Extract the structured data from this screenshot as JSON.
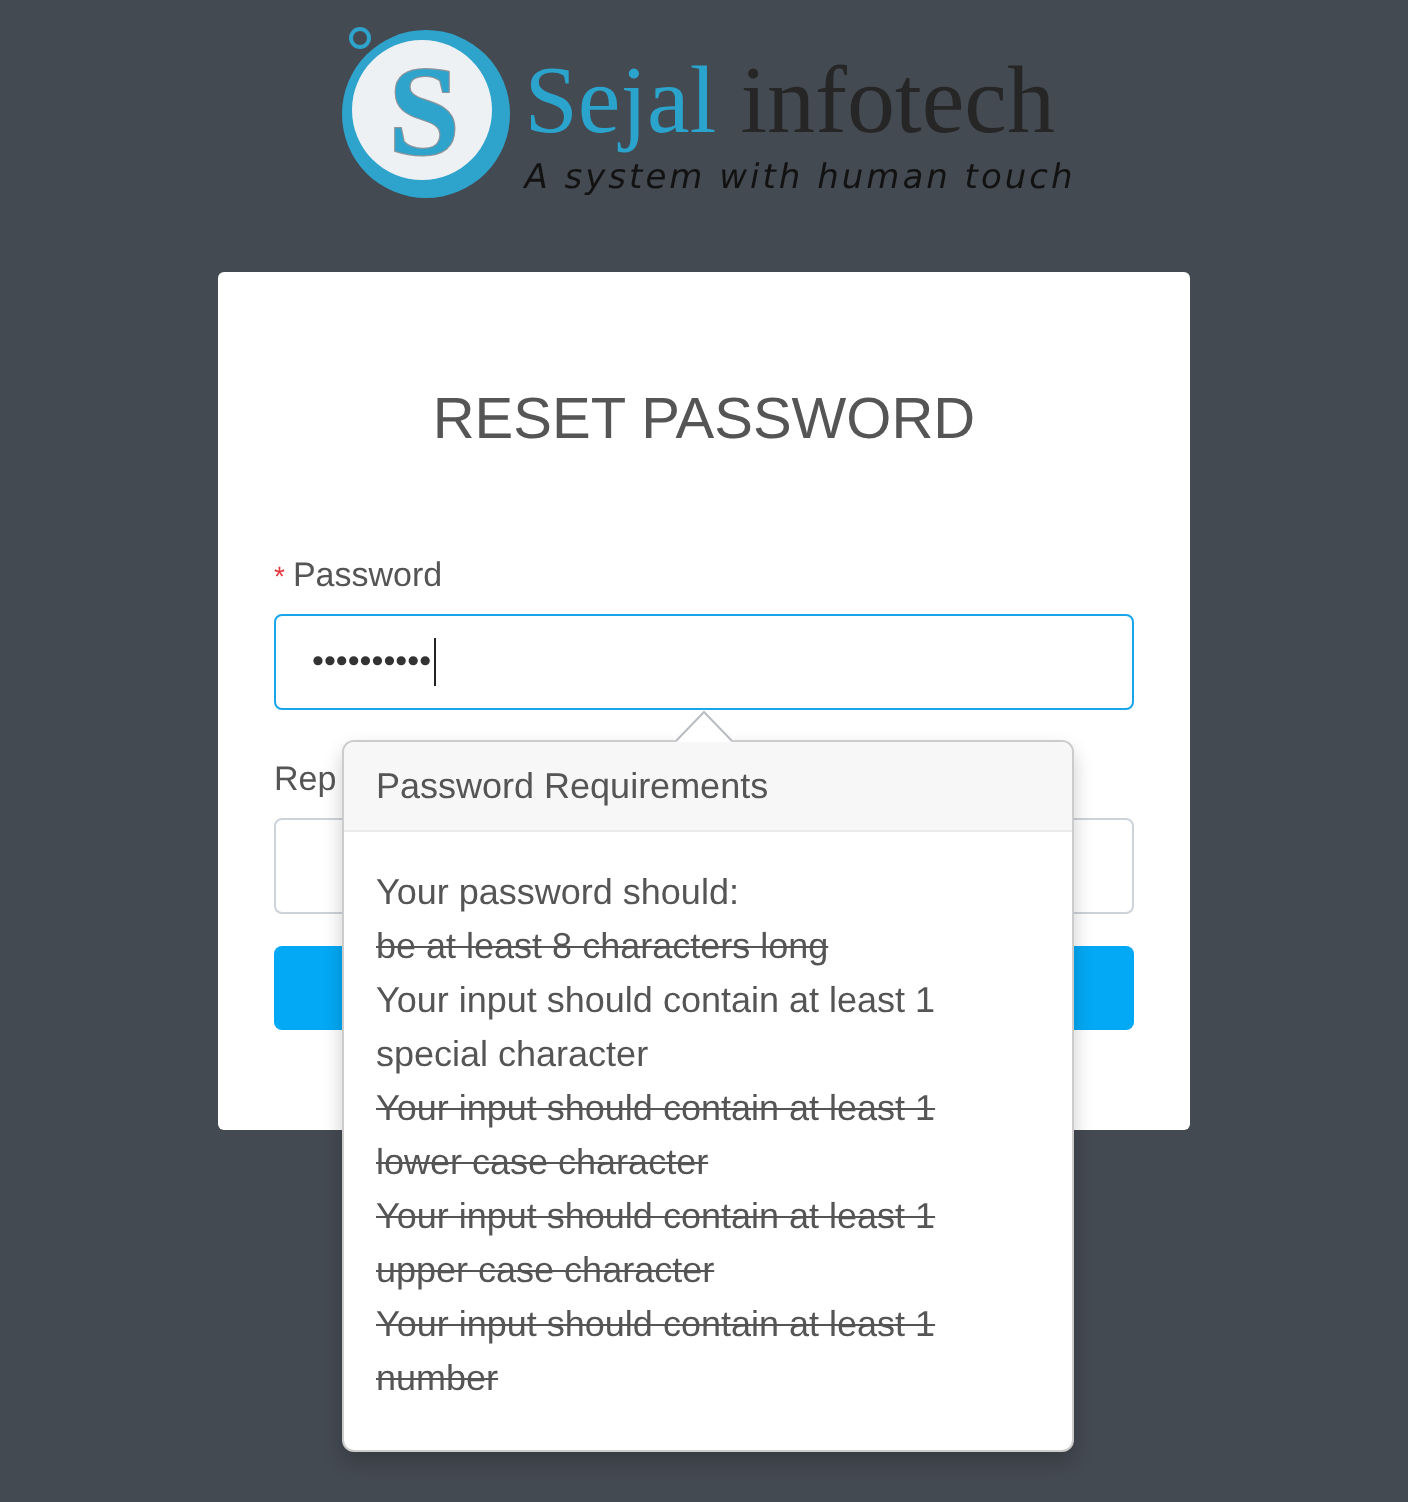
{
  "logo": {
    "mark": "S",
    "name_first": "Sejal",
    "name_second": "infotech",
    "tagline": "A system with human touch"
  },
  "title": "RESET PASSWORD",
  "fields": [
    {
      "label": "Password",
      "required_mark": "*",
      "value": "••••••••••",
      "focused": true
    },
    {
      "label": "Rep",
      "focused": false
    }
  ],
  "popover": {
    "title": "Password Requirements",
    "intro": "Your password should:",
    "requirements": [
      {
        "text": "be at least 8 characters long",
        "met": true
      },
      {
        "text": "Your input should contain at least 1 special character",
        "met": false
      },
      {
        "text": "Your input should contain at least 1 lower case character",
        "met": true
      },
      {
        "text": "Your input should contain at least 1 upper case character",
        "met": true
      },
      {
        "text": "Your input should contain at least 1 number",
        "met": true
      }
    ]
  }
}
